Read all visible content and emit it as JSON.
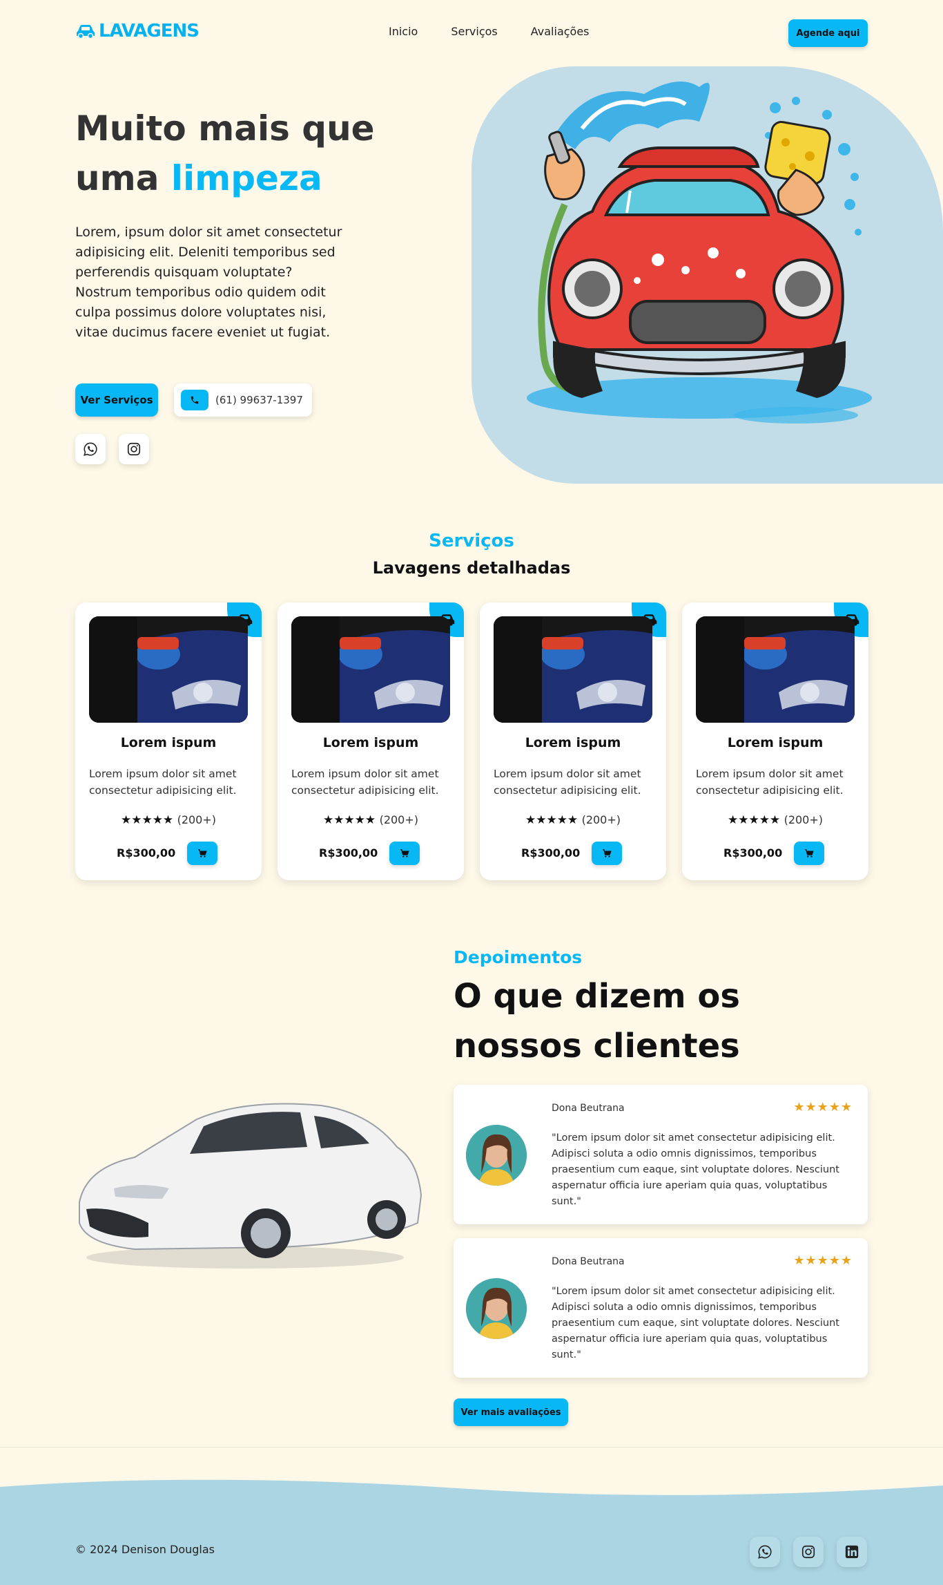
{
  "header": {
    "logo": "LAVAGENS",
    "nav": [
      "Inicio",
      "Serviços",
      "Avaliações"
    ],
    "cta": "Agende aqui"
  },
  "hero": {
    "title_line1": "Muito mais que",
    "title_line2_plain": "uma ",
    "title_line2_accent": "limpeza",
    "text": "Lorem, ipsum dolor sit amet consectetur adipisicing elit. Deleniti temporibus sed perferendis quisquam voluptate? Nostrum temporibus odio quidem odit culpa possimus dolore voluptates nisi, vitae ducimus facere eveniet ut fugiat.",
    "btn_services": "Ver Serviços",
    "phone": "(61) 99637-1397",
    "socials": [
      "whatsapp-icon",
      "instagram-icon"
    ]
  },
  "services": {
    "subtitle": "Serviços",
    "title": "Lavagens detalhadas",
    "cards": [
      {
        "title": "Lorem ispum",
        "text": "Lorem ipsum dolor sit amet consectetur adipisicing elit.",
        "stars": "★★★★★",
        "count": "(200+)",
        "price": "R$300,00",
        "rating": 5
      },
      {
        "title": "Lorem ispum",
        "text": "Lorem ipsum dolor sit amet consectetur adipisicing elit.",
        "stars": "★★★★★",
        "count": "(200+)",
        "price": "R$300,00",
        "rating": 5
      },
      {
        "title": "Lorem ispum",
        "text": "Lorem ipsum dolor sit amet consectetur adipisicing elit.",
        "stars": "★★★★★",
        "count": "(200+)",
        "price": "R$300,00",
        "rating": 5
      },
      {
        "title": "Lorem ispum",
        "text": "Lorem ipsum dolor sit amet consectetur adipisicing elit.",
        "stars": "★★★★★",
        "count": "(200+)",
        "price": "R$300,00",
        "rating": 5
      }
    ]
  },
  "testimonials": {
    "subtitle": "Depoimentos",
    "title": "O que dizem os nossos clientes",
    "items": [
      {
        "name": "Dona Beutrana",
        "stars": "★★★★★",
        "rating": 5,
        "quote": "\"Lorem ipsum dolor sit amet consectetur adipisicing elit. Adipisci soluta a odio omnis dignissimos, temporibus praesentium cum eaque, sint voluptate dolores. Nesciunt aspernatur officia iure aperiam quia quas, voluptatibus sunt.\""
      },
      {
        "name": "Dona Beutrana",
        "stars": "★★★★★",
        "rating": 5,
        "quote": "\"Lorem ipsum dolor sit amet consectetur adipisicing elit. Adipisci soluta a odio omnis dignissimos, temporibus praesentium cum eaque, sint voluptate dolores. Nesciunt aspernatur officia iure aperiam quia quas, voluptatibus sunt.\""
      }
    ],
    "more_btn": "Ver mais avaliações"
  },
  "footer": {
    "copyright": "© 2024 Denison Douglas",
    "socials": [
      "whatsapp-icon",
      "instagram-icon",
      "linkedin-icon"
    ]
  },
  "colors": {
    "accent": "#07b8f5",
    "background": "#fdf8e8",
    "hero_panel": "#c2dde8",
    "footer": "#acd5e4",
    "star_gold": "#e8a31a"
  }
}
